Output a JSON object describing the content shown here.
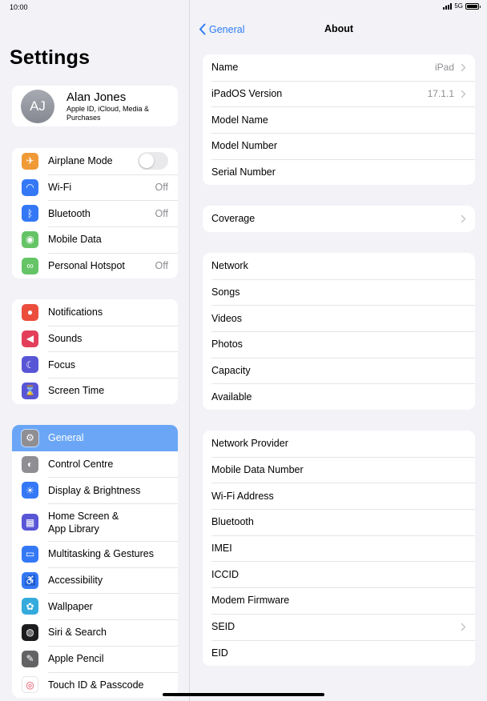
{
  "status_bar": {
    "time": "10:00",
    "network": "5G"
  },
  "sidebar": {
    "title": "Settings",
    "profile": {
      "initials": "AJ",
      "name": "Alan Jones",
      "subtitle": "Apple ID, iCloud, Media & Purchases"
    },
    "group1": [
      {
        "label": "Airplane Mode",
        "icon": "airplane-icon",
        "color": "#f09a37",
        "toggle": false
      },
      {
        "label": "Wi-Fi",
        "value": "Off",
        "icon": "wifi-icon",
        "color": "#3478f6"
      },
      {
        "label": "Bluetooth",
        "value": "Off",
        "icon": "bluetooth-icon",
        "color": "#3478f6"
      },
      {
        "label": "Mobile Data",
        "value": "",
        "icon": "antenna-icon",
        "color": "#65c466"
      },
      {
        "label": "Personal Hotspot",
        "value": "Off",
        "icon": "hotspot-icon",
        "color": "#65c466"
      }
    ],
    "group2": [
      {
        "label": "Notifications",
        "icon": "bell-icon",
        "color": "#eb4e3d"
      },
      {
        "label": "Sounds",
        "icon": "speaker-icon",
        "color": "#e33f5a"
      },
      {
        "label": "Focus",
        "icon": "moon-icon",
        "color": "#5856d6"
      },
      {
        "label": "Screen Time",
        "icon": "hourglass-icon",
        "color": "#5856d6"
      }
    ],
    "group3": [
      {
        "label": "General",
        "icon": "gear-icon",
        "color": "#8e8e93",
        "selected": true
      },
      {
        "label": "Control Centre",
        "icon": "switches-icon",
        "color": "#8e8e93"
      },
      {
        "label": "Display & Brightness",
        "icon": "sun-icon",
        "color": "#3478f6"
      },
      {
        "label": "Home Screen &\nApp Library",
        "icon": "grid-icon",
        "color": "#5856d6"
      },
      {
        "label": "Multitasking & Gestures",
        "icon": "multitasking-icon",
        "color": "#3478f6"
      },
      {
        "label": "Accessibility",
        "icon": "accessibility-icon",
        "color": "#3478f6"
      },
      {
        "label": "Wallpaper",
        "icon": "flower-icon",
        "color": "#35aadc"
      },
      {
        "label": "Siri & Search",
        "icon": "siri-icon",
        "color": "#1c1c1e"
      },
      {
        "label": "Apple Pencil",
        "icon": "pencil-icon",
        "color": "#636366"
      },
      {
        "label": "Touch ID & Passcode",
        "icon": "fingerprint-icon",
        "color": "#ffffff"
      }
    ]
  },
  "detail": {
    "back_label": "General",
    "title": "About",
    "group1": [
      {
        "label": "Name",
        "value": "iPad",
        "chevron": true
      },
      {
        "label": "iPadOS Version",
        "value": "17.1.1",
        "chevron": true
      },
      {
        "label": "Model Name"
      },
      {
        "label": "Model Number"
      },
      {
        "label": "Serial Number"
      }
    ],
    "group2": [
      {
        "label": "Coverage",
        "chevron": true
      }
    ],
    "group3": [
      {
        "label": "Network"
      },
      {
        "label": "Songs"
      },
      {
        "label": "Videos"
      },
      {
        "label": "Photos"
      },
      {
        "label": "Capacity"
      },
      {
        "label": "Available"
      }
    ],
    "group4": [
      {
        "label": "Network Provider"
      },
      {
        "label": "Mobile Data Number"
      },
      {
        "label": "Wi-Fi Address"
      },
      {
        "label": "Bluetooth"
      },
      {
        "label": "IMEI"
      },
      {
        "label": "ICCID"
      },
      {
        "label": "Modem Firmware"
      },
      {
        "label": "SEID",
        "chevron": true
      },
      {
        "label": "EID"
      }
    ]
  },
  "colors": {
    "accent": "#2e7cf6",
    "selected_row": "#6aa6f5",
    "background": "#f2f2f7"
  }
}
